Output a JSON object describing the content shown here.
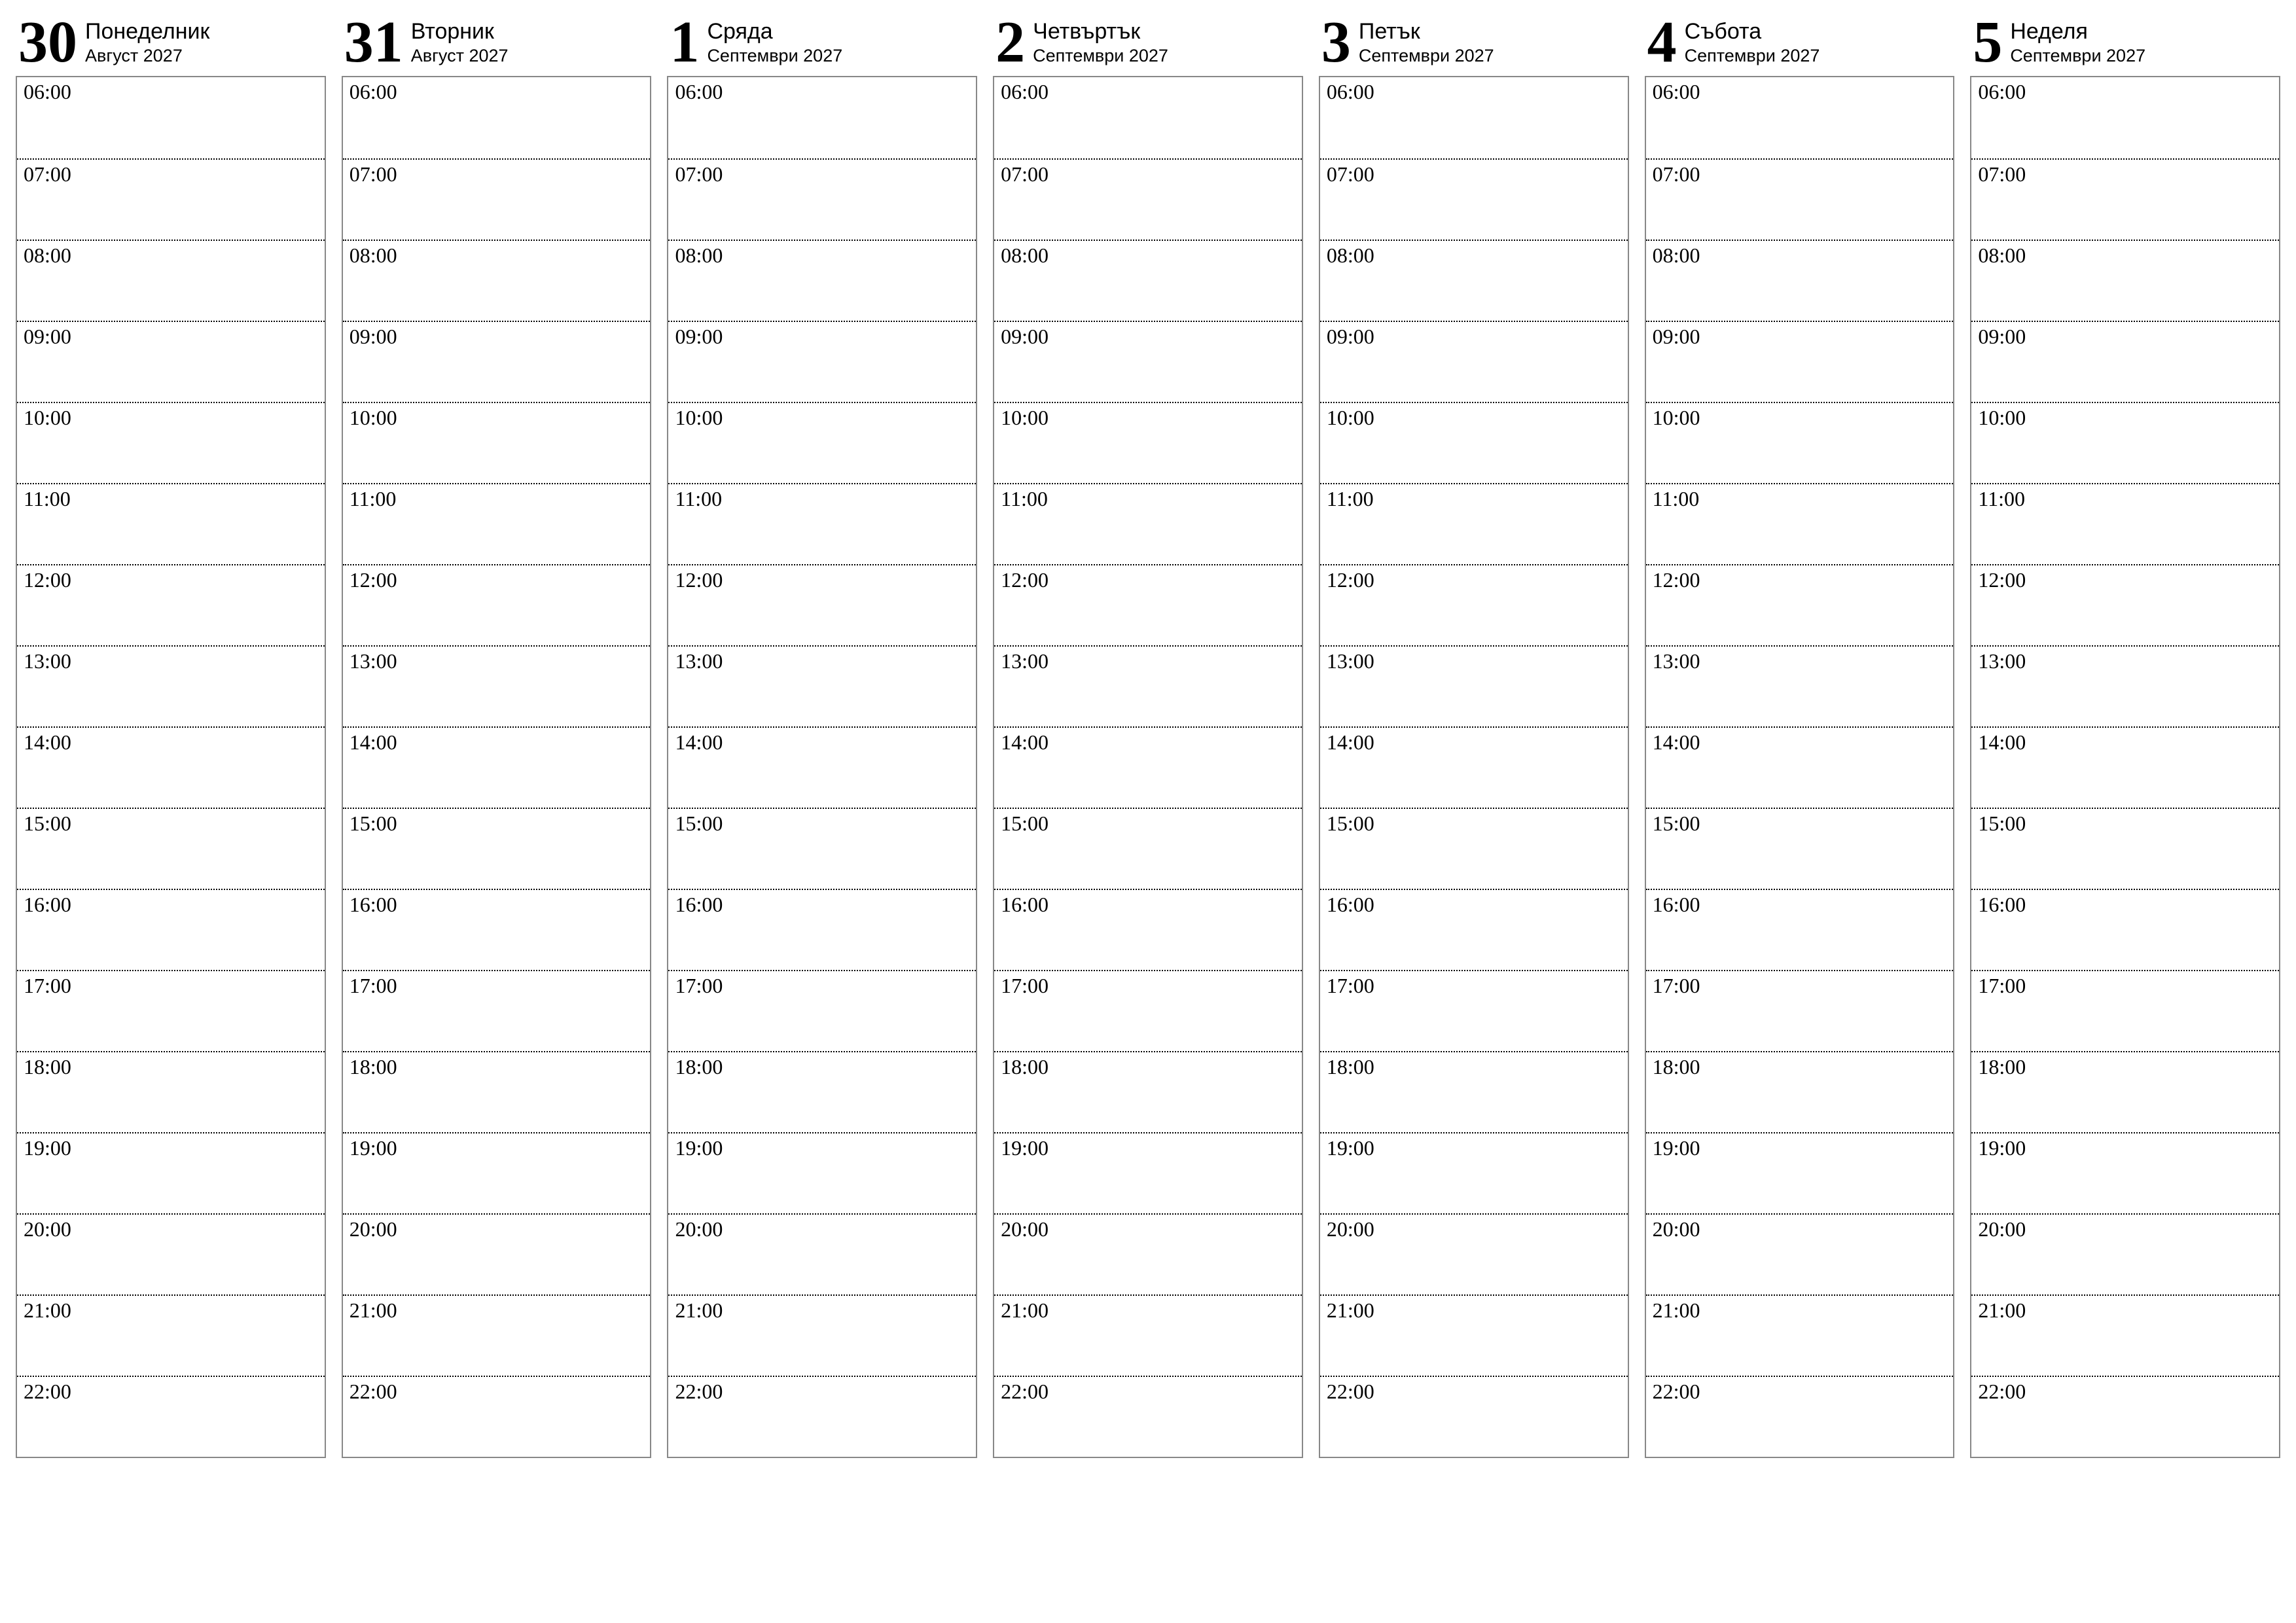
{
  "hours": [
    "06:00",
    "07:00",
    "08:00",
    "09:00",
    "10:00",
    "11:00",
    "12:00",
    "13:00",
    "14:00",
    "15:00",
    "16:00",
    "17:00",
    "18:00",
    "19:00",
    "20:00",
    "21:00",
    "22:00"
  ],
  "days": [
    {
      "number": "30",
      "name": "Понеделник",
      "sub": "Август 2027"
    },
    {
      "number": "31",
      "name": "Вторник",
      "sub": "Август 2027"
    },
    {
      "number": "1",
      "name": "Сряда",
      "sub": "Септември 2027"
    },
    {
      "number": "2",
      "name": "Четвъртък",
      "sub": "Септември 2027"
    },
    {
      "number": "3",
      "name": "Петък",
      "sub": "Септември 2027"
    },
    {
      "number": "4",
      "name": "Събота",
      "sub": "Септември 2027"
    },
    {
      "number": "5",
      "name": "Неделя",
      "sub": "Септември 2027"
    }
  ]
}
